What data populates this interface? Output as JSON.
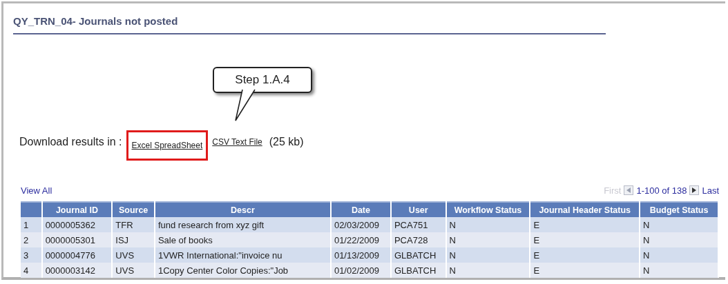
{
  "title": "QY_TRN_04- Journals not posted",
  "callout": {
    "text": "Step 1.A.4"
  },
  "download": {
    "label": "Download results in :",
    "links": [
      {
        "label": "Excel SpreadSheet",
        "highlighted": true
      },
      {
        "label": "CSV Text File",
        "highlighted": false
      }
    ],
    "size": "(25 kb)"
  },
  "view_all": "View All",
  "pager": {
    "first": "First",
    "first_disabled": true,
    "range": "1-100 of 138",
    "last": "Last"
  },
  "table": {
    "columns": [
      "",
      "Journal ID",
      "Source",
      "Descr",
      "Date",
      "User",
      "Workflow Status",
      "Journal Header Status",
      "Budget Status"
    ],
    "rows": [
      [
        "1",
        "0000005362",
        "TFR",
        "fund research from xyz gift",
        "02/03/2009",
        "PCA751",
        "N",
        "E",
        "N"
      ],
      [
        "2",
        "0000005301",
        "ISJ",
        "Sale of books",
        "01/22/2009",
        "PCA728",
        "N",
        "E",
        "N"
      ],
      [
        "3",
        "0000004776",
        "UVS",
        "1VWR International:\"invoice nu",
        "01/13/2009",
        "GLBATCH",
        "N",
        "E",
        "N"
      ],
      [
        "4",
        "0000003142",
        "UVS",
        "1Copy Center Color Copies:\"Job",
        "01/02/2009",
        "GLBATCH",
        "N",
        "E",
        "N"
      ]
    ]
  }
}
